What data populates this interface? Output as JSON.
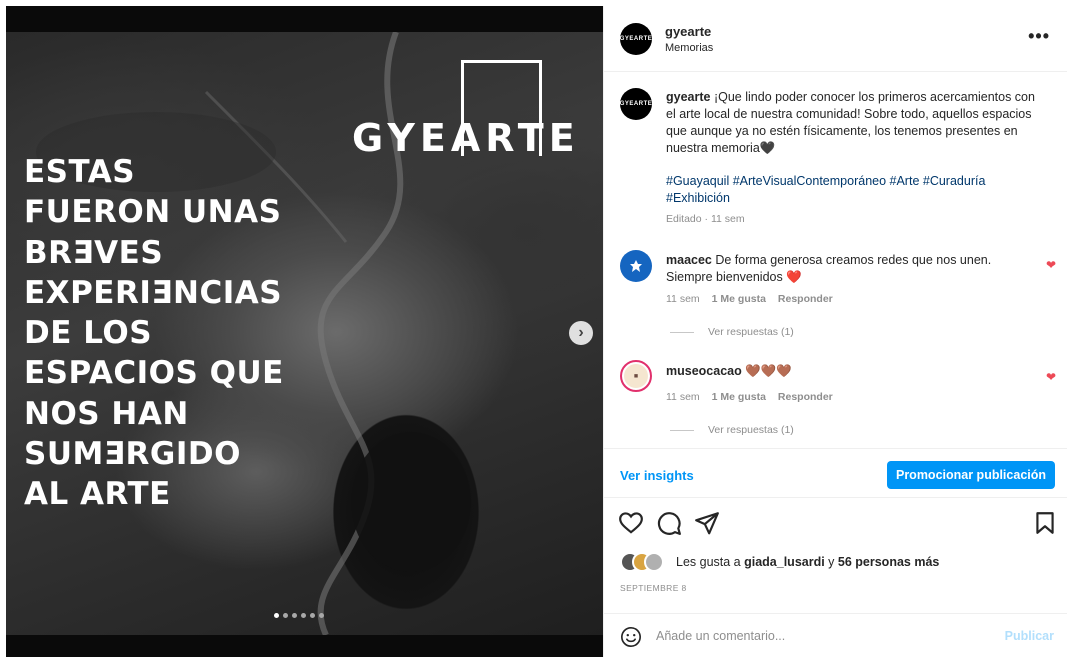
{
  "post": {
    "brand_logo_text": "GYEARTE",
    "poster_lines": [
      "ESTAS",
      "FUERON UNAS",
      "BRƎVES",
      "EXPERIƎNCIAS",
      "DE LOS",
      "ESPACIOS QUE",
      "NOS HAN",
      "SUMƎRGIDO",
      "AL ARTE"
    ],
    "carousel": {
      "count": 6,
      "active_index": 0
    }
  },
  "header": {
    "username": "gyearte",
    "location": "Memorias",
    "more_label": "•••",
    "avatar_text": "GYEARTE"
  },
  "caption": {
    "username": "gyearte",
    "text": "¡Que lindo poder conocer los primeros acercamientos con el arte local de nuestra comunidad! Sobre todo, aquellos espacios que aunque ya no estén físicamente, los tenemos presentes en nuestra memoria🖤",
    "hashtags": "#Guayaquil #ArteVisualContemporáneo #Arte #Curaduría #Exhibición",
    "meta": "Editado · 11 sem"
  },
  "comments": [
    {
      "username": "maacec",
      "text": "De forma generosa creamos redes que nos unen. Siempre bienvenidos ❤️",
      "time": "11 sem",
      "likes": "1 Me gusta",
      "reply": "Responder",
      "view_replies": "Ver respuestas (1)",
      "avatar_color": "#1565c0"
    },
    {
      "username": "museocacao",
      "text": "🤎🤎🤎",
      "time": "11 sem",
      "likes": "1 Me gusta",
      "reply": "Responder",
      "view_replies": "Ver respuestas (1)",
      "avatar_color": "#f0a030"
    }
  ],
  "insights": {
    "link": "Ver insights",
    "promote": "Promocionar publicación"
  },
  "likes": {
    "prefix": "Les gusta a ",
    "user": "giada_lusardi",
    "middle": " y ",
    "others": "56 personas más"
  },
  "date": "SEPTIEMBRE 8",
  "add_comment": {
    "placeholder": "Añade un comentario...",
    "publish": "Publicar"
  },
  "colors": {
    "accent": "#0095f6",
    "like_red": "#ed4956",
    "hashtag": "#00376b"
  }
}
